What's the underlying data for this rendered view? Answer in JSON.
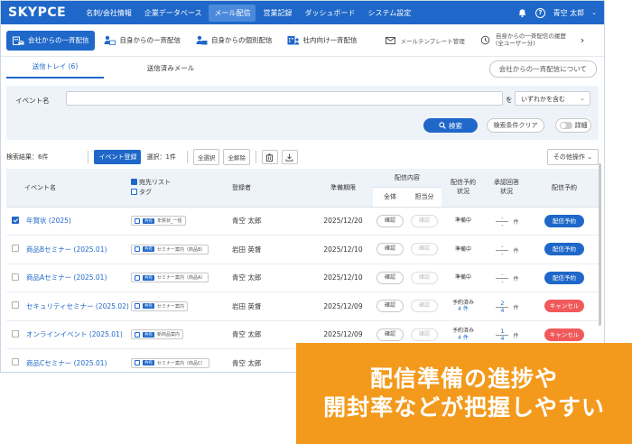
{
  "app": {
    "logo": "SKYPCE",
    "nav": [
      "名刺/会社情報",
      "企業データベース",
      "メール配信",
      "営業記録",
      "ダッシュボード",
      "システム設定"
    ],
    "nav_active_index": 2,
    "user": "青空 太郎"
  },
  "subnav": {
    "items": [
      {
        "label": "会社からの一斉配信",
        "icon": "company-mail-icon"
      },
      {
        "label": "自身からの一斉配信",
        "icon": "self-mail-icon"
      },
      {
        "label": "自身からの個別配信",
        "icon": "individual-mail-icon"
      },
      {
        "label": "社内向け一斉配信",
        "icon": "internal-mail-icon"
      },
      {
        "label": "メールテンプレート管理",
        "icon": "envelope-icon"
      },
      {
        "label_line1": "自身からの一斉配信の履歴",
        "label_line2": "(全ユーザー分)",
        "icon": "history-icon"
      }
    ],
    "more": "›"
  },
  "tabs": {
    "items": [
      "送信トレイ (6)",
      "送信済みメール"
    ],
    "right_button": "会社からの一斉配信について"
  },
  "search": {
    "label": "イベント名",
    "input_value": "",
    "wo": "を",
    "condition": "いずれかを含む",
    "search_button": "検索",
    "clear_button": "検索条件クリア",
    "detail_toggle": "詳細"
  },
  "results": {
    "count_text": "検索結果：6件",
    "register_button": "イベント登録",
    "selection_text": "選択：1件",
    "select_all": "全選択",
    "deselect_all": "全解除",
    "other_actions": "その他操作"
  },
  "table": {
    "headers": {
      "name": "イベント名",
      "dest_list": "宛先リスト",
      "tag": "タグ",
      "registrant": "登録者",
      "prep_deadline": "準備期限",
      "content": "配信内容",
      "content_all": "全体",
      "content_charge": "担当分",
      "schedule_status_1": "配信予約",
      "schedule_status_2": "状況",
      "approval_1": "承認回答",
      "approval_2": "状況",
      "schedule": "配信予約"
    },
    "rows": [
      {
        "checked": true,
        "name": "年賀状 (2025)",
        "tag_badge": "共有",
        "tag": "年賀状_一括",
        "registrant": "青空 太郎",
        "deadline": "2025/12/20",
        "all": "確認",
        "charge": "確認",
        "status1": "準備中",
        "status2": "",
        "appr_top": "-",
        "appr_bottom": "-",
        "appr_unit": "件",
        "action": "配信予約",
        "action_color": "blue"
      },
      {
        "checked": false,
        "name": "商品Bセミナー (2025.01)",
        "tag_badge": "共有",
        "tag": "セミナー案内（商品B）",
        "registrant": "岩田 英督",
        "deadline": "2025/12/10",
        "all": "確認",
        "charge": "確認",
        "status1": "準備中",
        "status2": "",
        "appr_top": "-",
        "appr_bottom": "-",
        "appr_unit": "件",
        "action": "配信予約",
        "action_color": "blue"
      },
      {
        "checked": false,
        "name": "商品Aセミナー (2025.01)",
        "tag_badge": "共有",
        "tag": "セミナー案内（商品A）",
        "registrant": "青空 太郎",
        "deadline": "2025/12/10",
        "all": "確認",
        "charge": "確認",
        "status1": "準備中",
        "status2": "",
        "appr_top": "-",
        "appr_bottom": "-",
        "appr_unit": "件",
        "action": "配信予約",
        "action_color": "blue"
      },
      {
        "checked": false,
        "name": "セキュリティセミナー (2025.02)",
        "tag_badge": "共有",
        "tag": "セミナー案内",
        "registrant": "岩田 英督",
        "deadline": "2025/12/09",
        "all": "確認",
        "charge": "確認",
        "status1": "予約済み",
        "status2": "4 件",
        "appr_top": "2",
        "appr_bottom": "4",
        "appr_unit": "件",
        "action": "キャンセル",
        "action_color": "red"
      },
      {
        "checked": false,
        "name": "オンラインイベント (2025.01)",
        "tag_badge": "共有",
        "tag": "新商品案内",
        "registrant": "青空 太郎",
        "deadline": "2025/12/09",
        "all": "確認",
        "charge": "確認",
        "status1": "予約済み",
        "status2": "4 件",
        "appr_top": "1",
        "appr_bottom": "4",
        "appr_unit": "件",
        "action": "キャンセル",
        "action_color": "red"
      },
      {
        "checked": false,
        "name": "商品Cセミナー (2025.01)",
        "tag_badge": "共有",
        "tag": "セミナー案内（商品C）",
        "registrant": "青空 太郎",
        "deadline": "",
        "all": "",
        "charge": "",
        "status1": "",
        "status2": "",
        "appr_top": "",
        "appr_bottom": "",
        "appr_unit": "",
        "action": "",
        "action_color": ""
      }
    ]
  },
  "overlay": {
    "line1": "配信準備の進捗や",
    "line2": "開封率などが把握しやすい"
  },
  "colors": {
    "primary": "#1f68c9",
    "danger": "#f05a5a",
    "overlay": "#f39a1c",
    "panel": "#eef3f9"
  }
}
